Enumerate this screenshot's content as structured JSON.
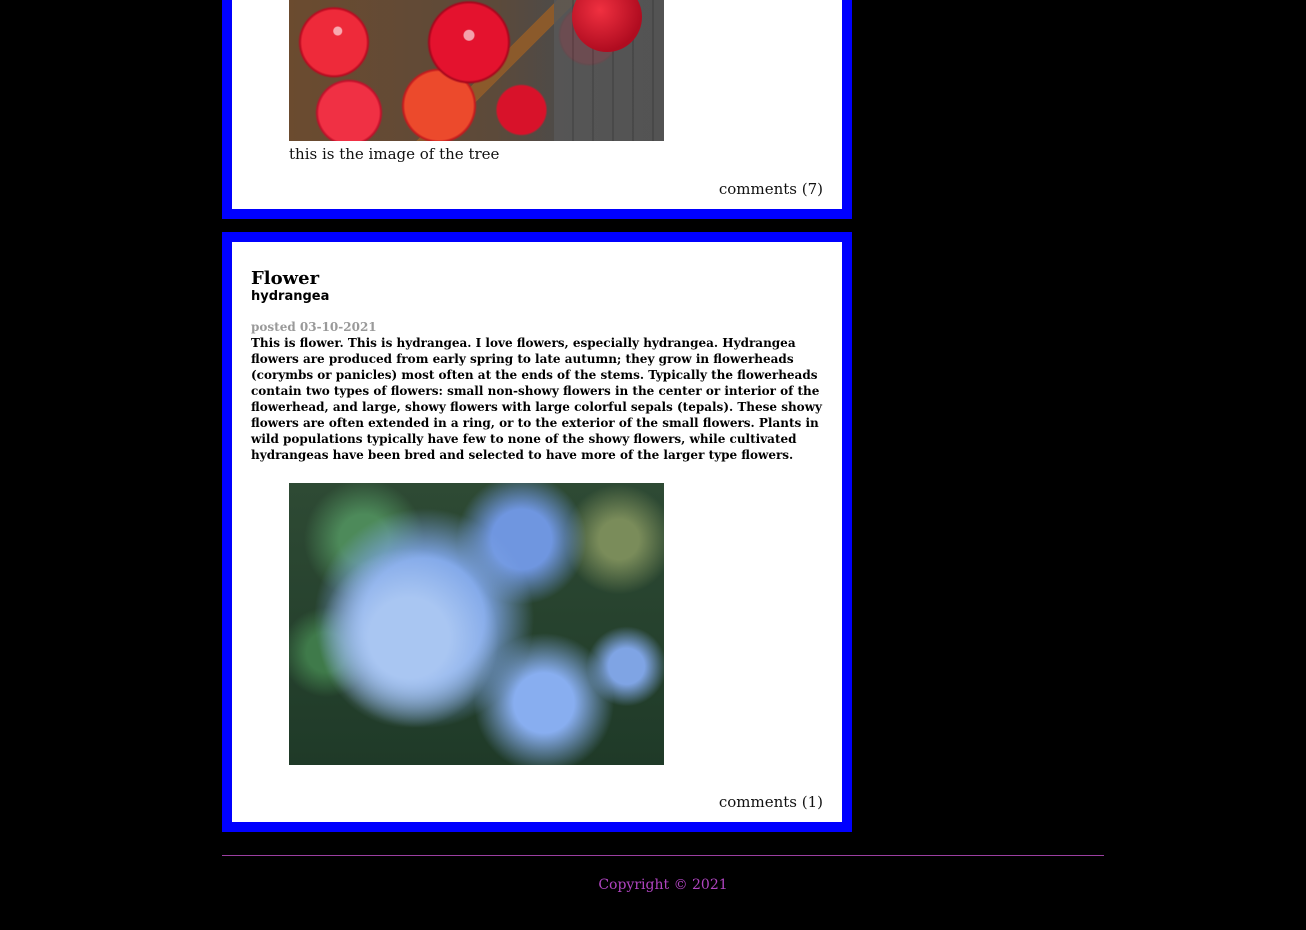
{
  "posts": [
    {
      "image_alt": "apples",
      "caption": "this is the image of the tree",
      "comments": "comments (7)"
    },
    {
      "title": "Flower",
      "subtitle": "hydrangea",
      "date": "posted 03-10-2021",
      "body": "This is flower. This is hydrangea. I love flowers, especially hydrangea. Hydrangea flowers are produced from early spring to late autumn; they grow in flowerheads (corymbs or panicles) most often at the ends of the stems. Typically the flowerheads contain two types of flowers: small non-showy flowers in the center or interior of the flowerhead, and large, showy flowers with large colorful sepals (tepals). These showy flowers are often extended in a ring, or to the exterior of the small flowers. Plants in wild populations typically have few to none of the showy flowers, while cultivated hydrangeas have been bred and selected to have more of the larger type flowers.",
      "image_alt": "hydrangea",
      "comments": "comments (1)"
    }
  ],
  "footer": {
    "copyright": "Copyright © 2021"
  },
  "colors": {
    "background": "#000000",
    "post_border": "#0000ff",
    "footer_accent": "#b044c0"
  }
}
